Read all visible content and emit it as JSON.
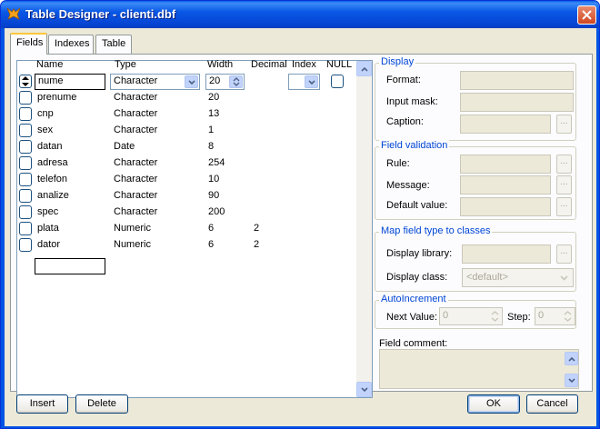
{
  "window": {
    "title": "Table Designer - clienti.dbf"
  },
  "tabs": [
    {
      "label": "Fields",
      "mnemonic_index": 0
    },
    {
      "label": "Indexes",
      "mnemonic_index": 0
    },
    {
      "label": "Table",
      "mnemonic_index": 0
    }
  ],
  "grid": {
    "headers": {
      "name": "Name",
      "type": "Type",
      "width": "Width",
      "decimal": "Decimal",
      "index": "Index",
      "null": "NULL"
    },
    "current": {
      "name": "nume",
      "type": "Character",
      "width": "20"
    },
    "rows": [
      {
        "name": "prenume",
        "type": "Character",
        "width": "20",
        "decimal": ""
      },
      {
        "name": "cnp",
        "type": "Character",
        "width": "13",
        "decimal": ""
      },
      {
        "name": "sex",
        "type": "Character",
        "width": "1",
        "decimal": ""
      },
      {
        "name": "datan",
        "type": "Date",
        "width": "8",
        "decimal": ""
      },
      {
        "name": "adresa",
        "type": "Character",
        "width": "254",
        "decimal": ""
      },
      {
        "name": "telefon",
        "type": "Character",
        "width": "10",
        "decimal": ""
      },
      {
        "name": "analize",
        "type": "Character",
        "width": "90",
        "decimal": ""
      },
      {
        "name": "spec",
        "type": "Character",
        "width": "200",
        "decimal": ""
      },
      {
        "name": "plata",
        "type": "Numeric",
        "width": "6",
        "decimal": "2"
      },
      {
        "name": "dator",
        "type": "Numeric",
        "width": "6",
        "decimal": "2"
      }
    ]
  },
  "display": {
    "title": "Display",
    "format_label": "Format:",
    "input_mask_label": "Input mask:",
    "caption_label": "Caption:",
    "caption_button": "..."
  },
  "validation": {
    "title": "Field validation",
    "rule_label": "Rule:",
    "message_label": "Message:",
    "default_label": "Default value:",
    "button": "..."
  },
  "map": {
    "title": "Map field type to classes",
    "library_label": "Display library:",
    "class_label": "Display class:",
    "class_value": "<default>",
    "button": "..."
  },
  "autoinc": {
    "title": "AutoIncrement",
    "next_label": "Next Value:",
    "next_value": "0",
    "step_label": "Step:",
    "step_value": "0"
  },
  "comment": {
    "label": "Field comment:"
  },
  "buttons": {
    "insert": "Insert",
    "delete": "Delete",
    "ok": "OK",
    "cancel": "Cancel"
  },
  "colors": {
    "title_bar": "#0a58e6",
    "face": "#ece9d8",
    "group_title": "#0046d5",
    "tab_highlight": "#ffc83c"
  }
}
